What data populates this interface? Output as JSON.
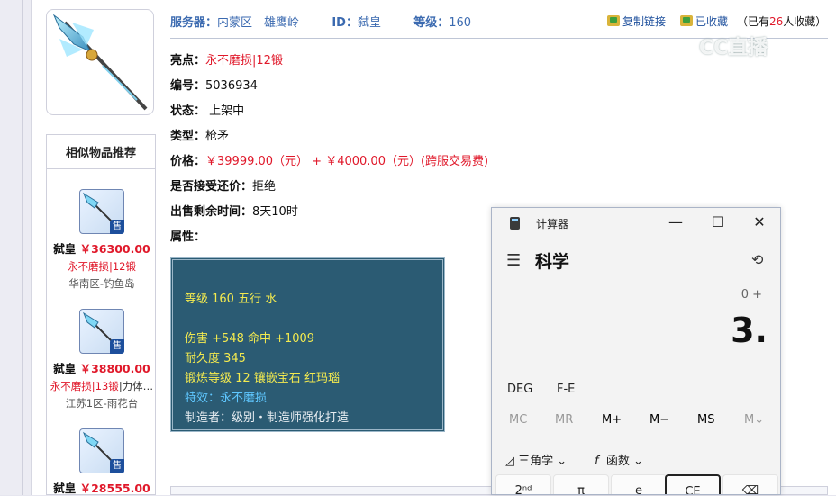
{
  "header": {
    "server_label": "服务器：",
    "server_value": "内蒙区—雄鹰岭",
    "id_label": "ID：",
    "id_value": "弑皇",
    "level_label": "等级：",
    "level_value": "160",
    "copy_link": "复制链接",
    "favorited": "已收藏",
    "fav_count_prefix": "（已有",
    "fav_count": "26",
    "fav_count_suffix": "人收藏）"
  },
  "watermark": "CC直播",
  "details": {
    "highlight_label": "亮点：",
    "highlight_value1": "永不磨损",
    "highlight_value2": "|12锻",
    "serial_label": "编号：",
    "serial_value": "5036934",
    "status_label": "状态：",
    "status_value": "上架中",
    "type_label": "类型：",
    "type_value": "枪矛",
    "price_label": "价格：",
    "price_value": "￥39999.00（元） + ￥4000.00（元）(跨服交易费)",
    "counter_label": "是否接受还价：",
    "counter_value": "拒绝",
    "time_label": "出售剩余时间：",
    "time_value": "8天10时",
    "attr_label": "属性："
  },
  "attributes": {
    "line1": "等级 160 五行 水",
    "line2": "伤害 +548 命中 +1009",
    "line3": "耐久度 345",
    "line4": "锻炼等级 12 镶嵌宝石 红玛瑙",
    "line5": "特效：永不磨损",
    "line6": "制造者：级别・制造师强化打造"
  },
  "similar": {
    "title": "相似物品推荐",
    "sale_tag": "售",
    "items": [
      {
        "name": "弑皇",
        "price": "￥36300.00",
        "tags": "永不磨损|12锻",
        "tags_extra": "",
        "server": "华南区-钓鱼岛"
      },
      {
        "name": "弑皇",
        "price": "￥38800.00",
        "tags": "永不磨损|13锻",
        "tags_extra": "|力体…",
        "server": "江苏1区-雨花台"
      },
      {
        "name": "弑皇",
        "price": "￥28555.00",
        "tags": "",
        "tags_extra": "",
        "server": ""
      }
    ]
  },
  "calculator": {
    "title": "计算器",
    "minimize": "—",
    "maximize": "☐",
    "close": "✕",
    "mode": "科学",
    "expression": "0 +",
    "display": "3.",
    "deg": "DEG",
    "fe": "F-E",
    "mem": [
      "MC",
      "MR",
      "M+",
      "M−",
      "MS",
      "M⌄"
    ],
    "trig": "三角学",
    "func": "函数",
    "keys": [
      "2ⁿᵈ",
      "π",
      "e",
      "CE",
      "⌫"
    ]
  }
}
